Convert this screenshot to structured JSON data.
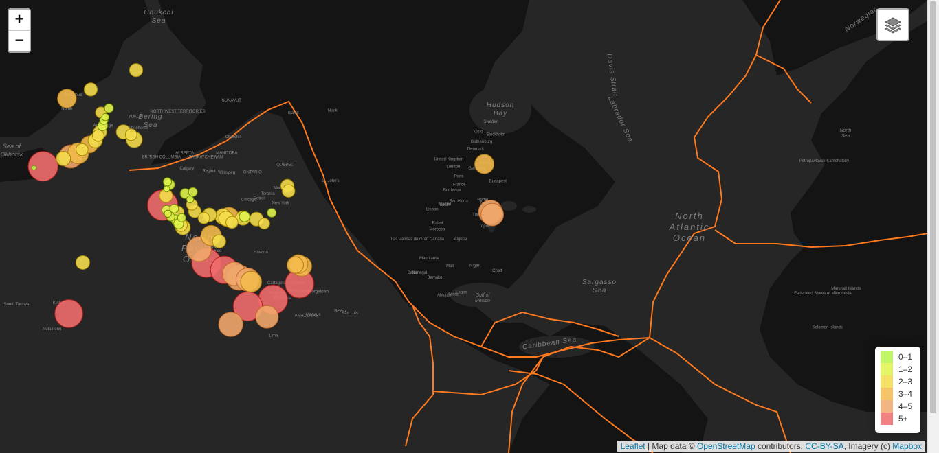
{
  "zoom": {
    "in_label": "+",
    "out_label": "−"
  },
  "legend": {
    "items": [
      {
        "label": "0–1",
        "color": "#b7f34d"
      },
      {
        "label": "1–2",
        "color": "#e1f34d"
      },
      {
        "label": "2–3",
        "color": "#f3db4d"
      },
      {
        "label": "3–4",
        "color": "#f3ba4d"
      },
      {
        "label": "4–5",
        "color": "#f0a76b"
      },
      {
        "label": "5+",
        "color": "#f06b6b"
      }
    ]
  },
  "attribution": {
    "leaflet": "Leaflet",
    "sep": " | Map data © ",
    "osm": "OpenStreetMap",
    "contrib": " contributors, ",
    "license": "CC-BY-SA",
    "imagery": ", Imagery (c) ",
    "mapbox": "Mapbox"
  },
  "map_labels": {
    "north_pacific": [
      "North",
      "Pacific",
      "Ocean"
    ],
    "north_atlantic": [
      "North",
      "Atlantic",
      "Ocean"
    ],
    "sargasso": [
      "Sargasso",
      "Sea"
    ],
    "bering": [
      "Bering",
      "Sea"
    ],
    "chukchi": [
      "Chukchi",
      "Sea"
    ],
    "okhotsk": [
      "Sea of",
      "Okhotsk"
    ],
    "hudson": [
      "Hudson",
      "Bay"
    ],
    "labrador": "Labrador Sea",
    "davis": "Davis Strait",
    "caribbean": "Caribbean Sea",
    "gulf_mexico": [
      "Gulf of",
      "Mexico"
    ],
    "north_sea": [
      "North",
      "Sea"
    ],
    "norwegian": "Norwegian",
    "places": [
      "Mauritania",
      "Mali",
      "Niger",
      "Chad",
      "Senegal",
      "Morocco",
      "Algeria",
      "Germany",
      "France",
      "Spain",
      "United Kingdom",
      "Sweden",
      "Denmark",
      "Venezuela",
      "Colombia",
      "AMAZONAS",
      "Mexico",
      "Havana",
      "Toronto",
      "New York",
      "Chicago",
      "Detroit",
      "Montréal",
      "Calgary",
      "Regina",
      "Winnipeg",
      "ALBERTA",
      "SASKATCHEWAN",
      "MANITOBA",
      "ONTARIO",
      "QUEBEC",
      "BRITISH COLUMBIA",
      "NORTHWEST TERRITORIES",
      "YUKON",
      "NUNAVUT",
      "Whitehorse",
      "Nome",
      "Kotzebue",
      "Anchorage",
      "Iqaluit",
      "Churchill",
      "Nuuk",
      "St. John's",
      "Berlin",
      "Barcelona",
      "Lagos",
      "Accra",
      "Abidjan",
      "Bamako",
      "Dakar",
      "Tripoli",
      "Tunis",
      "Madrid",
      "Paris",
      "London",
      "Stockholm",
      "Oslo",
      "Gothenburg",
      "Budapest",
      "Rome",
      "Naples",
      "Bordeaux",
      "Lisbon",
      "Rabat",
      "Las Palmas de Gran Canaria",
      "Bogotá",
      "Caracas",
      "Quito",
      "Lima",
      "Manaus",
      "Belém",
      "São Luís",
      "Georgetown",
      "Cartagena",
      "Medellín",
      "Marshall Islands",
      "Federated States of Micronesia",
      "Kiribati",
      "South Tarawa",
      "Nukunonu",
      "Solomon Islands",
      "Petropavlovsk-Kamchatsky"
    ]
  },
  "chart_data": {
    "type": "scatter",
    "title": "",
    "xlabel": "longitude",
    "ylabel": "latitude",
    "series": [
      {
        "name": "earthquakes",
        "points": [
          [
            -149.6,
            62.5,
            1.5
          ],
          [
            -150.1,
            61.4,
            1.8
          ],
          [
            -151.2,
            60.1,
            2.4
          ],
          [
            -152.0,
            59.3,
            2.1
          ],
          [
            -148.9,
            63.1,
            1.3
          ],
          [
            -147.4,
            64.8,
            1.6
          ],
          [
            -150.8,
            64.0,
            2.0
          ],
          [
            -153.3,
            58.2,
            2.6
          ],
          [
            -155.8,
            57.3,
            3.1
          ],
          [
            -158.9,
            56.1,
            2.2
          ],
          [
            -160.6,
            55.2,
            3.8
          ],
          [
            -163.8,
            54.4,
            4.2
          ],
          [
            -166.9,
            53.9,
            2.6
          ],
          [
            -175.6,
            51.9,
            5.4
          ],
          [
            -179.5,
            51.5,
            0.8
          ],
          [
            -165.4,
            66.5,
            3.4
          ],
          [
            -141.2,
            60.1,
            2.6
          ],
          [
            -137.9,
            59.5,
            2.1
          ],
          [
            -136.6,
            58.4,
            2.9
          ],
          [
            -135.8,
            70.9,
            2.4
          ],
          [
            -155.2,
            68.0,
            2.4
          ],
          [
            -122.4,
            47.6,
            1.5
          ],
          [
            -121.5,
            46.8,
            1.9
          ],
          [
            -122.7,
            45.5,
            1.1
          ],
          [
            -123.0,
            43.4,
            2.4
          ],
          [
            -124.4,
            40.4,
            5.5
          ],
          [
            -122.8,
            38.8,
            1.7
          ],
          [
            -122.2,
            37.6,
            1.3
          ],
          [
            -121.0,
            36.5,
            1.5
          ],
          [
            -118.6,
            35.4,
            1.9
          ],
          [
            -117.6,
            34.1,
            1.8
          ],
          [
            -116.6,
            33.6,
            2.3
          ],
          [
            -115.8,
            32.8,
            2.7
          ],
          [
            -116.3,
            36.2,
            1.5
          ],
          [
            -117.9,
            38.1,
            2.2
          ],
          [
            -119.5,
            39.3,
            1.6
          ],
          [
            -114.8,
            44.1,
            1.8
          ],
          [
            -111.5,
            44.6,
            1.6
          ],
          [
            -112.7,
            42.3,
            1.3
          ],
          [
            -111.9,
            40.6,
            2.0
          ],
          [
            -110.7,
            38.4,
            2.3
          ],
          [
            -106.8,
            36.1,
            2.1
          ],
          [
            -104.4,
            37.2,
            2.5
          ],
          [
            -98.6,
            36.6,
            2.9
          ],
          [
            -97.3,
            35.9,
            2.7
          ],
          [
            -96.1,
            36.4,
            3.6
          ],
          [
            -94.8,
            34.6,
            2.2
          ],
          [
            -90.1,
            36.1,
            2.6
          ],
          [
            -89.4,
            36.6,
            1.9
          ],
          [
            -84.3,
            35.7,
            2.5
          ],
          [
            -81.0,
            34.2,
            2.0
          ],
          [
            -77.8,
            37.9,
            1.6
          ],
          [
            -71.1,
            46.4,
            2.4
          ],
          [
            -70.6,
            44.9,
            2.3
          ],
          [
            -103.7,
            29.8,
            3.7
          ],
          [
            -100.3,
            27.6,
            2.4
          ],
          [
            -108.9,
            24.6,
            4.5
          ],
          [
            -105.7,
            19.2,
            5.3
          ],
          [
            -98.1,
            16.3,
            5.0
          ],
          [
            -93.8,
            14.7,
            4.3
          ],
          [
            -91.7,
            13.1,
            4.6
          ],
          [
            -88.1,
            12.3,
            4.2
          ],
          [
            -86.6,
            11.4,
            3.8
          ],
          [
            -67.7,
            18.3,
            3.0
          ],
          [
            -66.3,
            18.7,
            3.4
          ],
          [
            -64.9,
            17.8,
            3.6
          ],
          [
            -65.9,
            10.6,
            5.2
          ],
          [
            -77.2,
            3.8,
            5.3
          ],
          [
            -79.8,
            -3.6,
            4.1
          ],
          [
            -88.0,
            0.9,
            5.3
          ],
          [
            -95.3,
            -6.8,
            4.4
          ],
          [
            -158.6,
            19.3,
            2.5
          ],
          [
            -164.6,
            -2.2,
            5.1
          ],
          [
            13.2,
            52.5,
            3.5
          ],
          [
            15.8,
            38.2,
            4.3
          ],
          [
            16.6,
            37.3,
            4.1
          ]
        ]
      }
    ],
    "bins": [
      "0–1",
      "1–2",
      "2–3",
      "3–4",
      "4–5",
      "5+"
    ],
    "tectonic_plate_boundaries": true,
    "legend_position": "bottom-right"
  }
}
